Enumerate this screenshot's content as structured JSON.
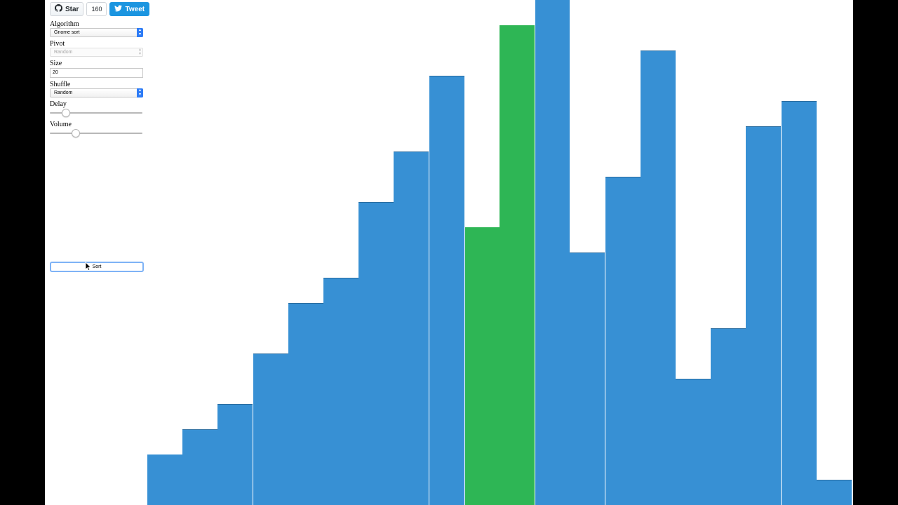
{
  "social": {
    "star_label": "Star",
    "star_count": "160",
    "tweet_label": "Tweet"
  },
  "controls": {
    "algorithm": {
      "label": "Algorithm",
      "value": "Gnome sort"
    },
    "pivot": {
      "label": "Pivot",
      "value": "Random",
      "disabled": true
    },
    "size": {
      "label": "Size",
      "value": "20"
    },
    "shuffle": {
      "label": "Shuffle",
      "value": "Random"
    },
    "delay": {
      "label": "Delay",
      "level": 0.17
    },
    "volume": {
      "label": "Volume",
      "level": 0.27
    },
    "sort_label": "Sort"
  },
  "colors": {
    "bar_default": "#3790d4",
    "bar_active": "#2eb655",
    "select_accent": "#2e7cf6",
    "tweet_blue": "#1b95e0"
  },
  "icons": {
    "github": "github-icon",
    "twitter": "twitter-bird-icon",
    "cursor": "mouse-pointer-icon"
  },
  "bars": {
    "max_value": 20,
    "values": [
      2,
      3,
      4,
      6,
      8,
      9,
      12,
      14,
      17,
      11,
      19,
      20,
      10,
      13,
      18,
      5,
      7,
      15,
      16,
      1
    ],
    "active_indices": [
      9,
      10
    ]
  }
}
